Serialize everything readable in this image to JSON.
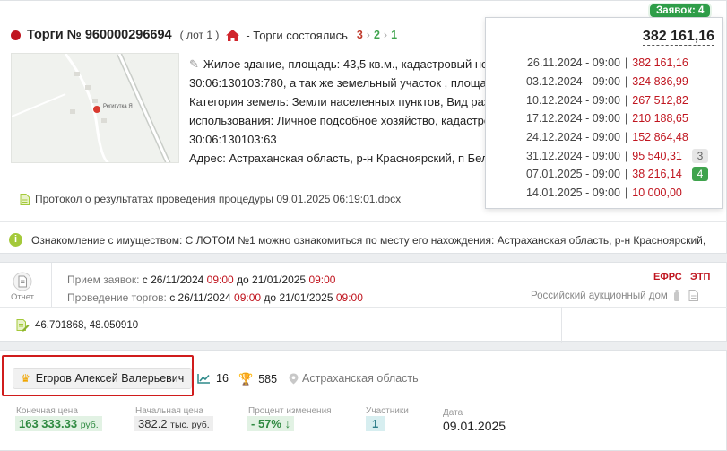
{
  "auction": {
    "title": "Торги № 960000296694",
    "lot": "( лот 1 )",
    "status": "- Торги состоялись",
    "steps": [
      "3",
      "2",
      "1"
    ],
    "description_lines": [
      "Жилое здание, площадь: 43,5 кв.м., кадастровый ном",
      "30:06:130103:780, а так же земельный участок , площади",
      "Категория земель: Земли населенных пунктов, Вид разр",
      "использования: Личное подсобное хозяйство, кадастро",
      "30:06:130103:63"
    ],
    "address": "Адрес: Астраханская область, р-н Красноярский, п Беля",
    "map_label": "Регигутка Я",
    "protocol": "Протокол о результатах проведения процедуры 09.01.2025 06:19:01.docx",
    "info": "Ознакомление с имуществом: С ЛОТОМ №1 можно ознакомиться по месту его нахождения: Астраханская область, р-н Красноярский,"
  },
  "popup": {
    "applications_label": "Заявок: 4",
    "total": "382 161,16",
    "bids": [
      {
        "date": "26.11.2024 - 09:00",
        "price": "382 161,16",
        "badge": ""
      },
      {
        "date": "03.12.2024 - 09:00",
        "price": "324 836,99",
        "badge": ""
      },
      {
        "date": "10.12.2024 - 09:00",
        "price": "267 512,82",
        "badge": ""
      },
      {
        "date": "17.12.2024 - 09:00",
        "price": "210 188,65",
        "badge": ""
      },
      {
        "date": "24.12.2024 - 09:00",
        "price": "152 864,48",
        "badge": ""
      },
      {
        "date": "31.12.2024 - 09:00",
        "price": "95 540,31",
        "badge": "3"
      },
      {
        "date": "07.01.2025 - 09:00",
        "price": "38 216,14",
        "badge": "4"
      },
      {
        "date": "14.01.2025 - 09:00",
        "price": "10 000,00",
        "badge": ""
      }
    ]
  },
  "schedule": {
    "report_label": "Отчет",
    "apps_label": "Прием заявок:",
    "trades_label": "Проведение торгов:",
    "from": "с",
    "to": "до",
    "apps_from_date": "26/11/2024",
    "apps_from_time": "09:00",
    "apps_to_date": "21/01/2025",
    "apps_to_time": "09:00",
    "trades_from_date": "26/11/2024",
    "trades_from_time": "09:00",
    "trades_to_date": "21/01/2025",
    "trades_to_time": "09:00",
    "efrs": "ЕФРС",
    "etp": "ЭТП",
    "platform": "Российский аукционный дом",
    "coords": "46.701868, 48.050910"
  },
  "result": {
    "winner": "Егоров Алексей Валерьевич",
    "stat_trend": "16",
    "stat_wins": "585",
    "region": "Астраханская область",
    "final_price_label": "Конечная цена",
    "final_price": "163 333.33",
    "final_price_unit": "руб.",
    "start_price_label": "Начальная цена",
    "start_price": "382.2",
    "start_price_unit": "тыс. руб.",
    "change_label": "Процент изменения",
    "change": "- 57%",
    "participants_label": "Участники",
    "participants": "1",
    "date_label": "Дата",
    "date": "09.01.2025"
  },
  "colors": {
    "accent_red": "#c0151f",
    "green": "#2f9e49",
    "highlight_border": "#d01c1c"
  }
}
